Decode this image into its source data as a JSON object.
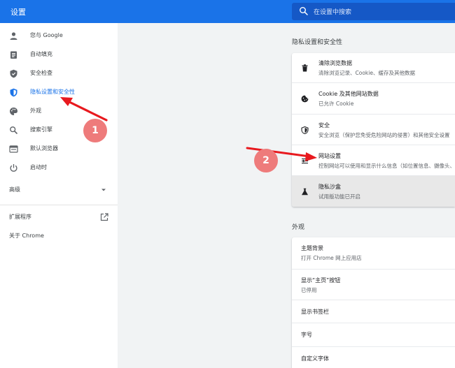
{
  "header": {
    "title": "设置",
    "search_placeholder": "在设置中搜索"
  },
  "sidebar": {
    "items": [
      {
        "label": "您与 Google",
        "icon": "person-icon"
      },
      {
        "label": "自动填充",
        "icon": "clipboard-icon"
      },
      {
        "label": "安全检查",
        "icon": "shield-check-icon"
      },
      {
        "label": "隐私设置和安全性",
        "icon": "privacy-shield-icon",
        "active": true
      },
      {
        "label": "外观",
        "icon": "palette-icon"
      },
      {
        "label": "搜索引擎",
        "icon": "search-icon"
      },
      {
        "label": "默认浏览器",
        "icon": "browser-window-icon"
      },
      {
        "label": "启动时",
        "icon": "power-icon"
      }
    ],
    "advanced_label": "高级",
    "extensions_label": "扩展程序",
    "about_label": "关于 Chrome"
  },
  "privacy_section": {
    "title": "隐私设置和安全性",
    "rows": [
      {
        "title": "清除浏览数据",
        "subtitle": "清除浏览记录、Cookie、缓存及其他数据",
        "icon": "trash-icon"
      },
      {
        "title": "Cookie 及其他网站数据",
        "subtitle": "已允许 Cookie",
        "icon": "cookie-icon"
      },
      {
        "title": "安全",
        "subtitle": "安全浏览（保护您免受危险网站的侵害）和其他安全设置",
        "icon": "security-shield-icon"
      },
      {
        "title": "网站设置",
        "subtitle": "控制网站可以使用和显示什么信息（如位置信息、摄像头、弹出式窗口及其他）",
        "icon": "sliders-icon"
      },
      {
        "title": "隐私沙盒",
        "subtitle": "试用版功能已开启",
        "icon": "flask-icon"
      }
    ]
  },
  "appearance_section": {
    "title": "外观",
    "rows": [
      {
        "title": "主题背景",
        "subtitle": "打开 Chrome 网上应用店"
      },
      {
        "title": "显示“主页”按钮",
        "subtitle": "已停用"
      },
      {
        "title": "显示书签栏",
        "subtitle": ""
      },
      {
        "title": "字号",
        "subtitle": ""
      },
      {
        "title": "自定义字体",
        "subtitle": ""
      }
    ]
  },
  "annotations": {
    "badge1": "1",
    "badge2": "2",
    "color": "#e8191e",
    "badge_color": "#ee7b7b"
  },
  "colors": {
    "accent": "#1a73e8",
    "background": "#f1f3f4"
  }
}
